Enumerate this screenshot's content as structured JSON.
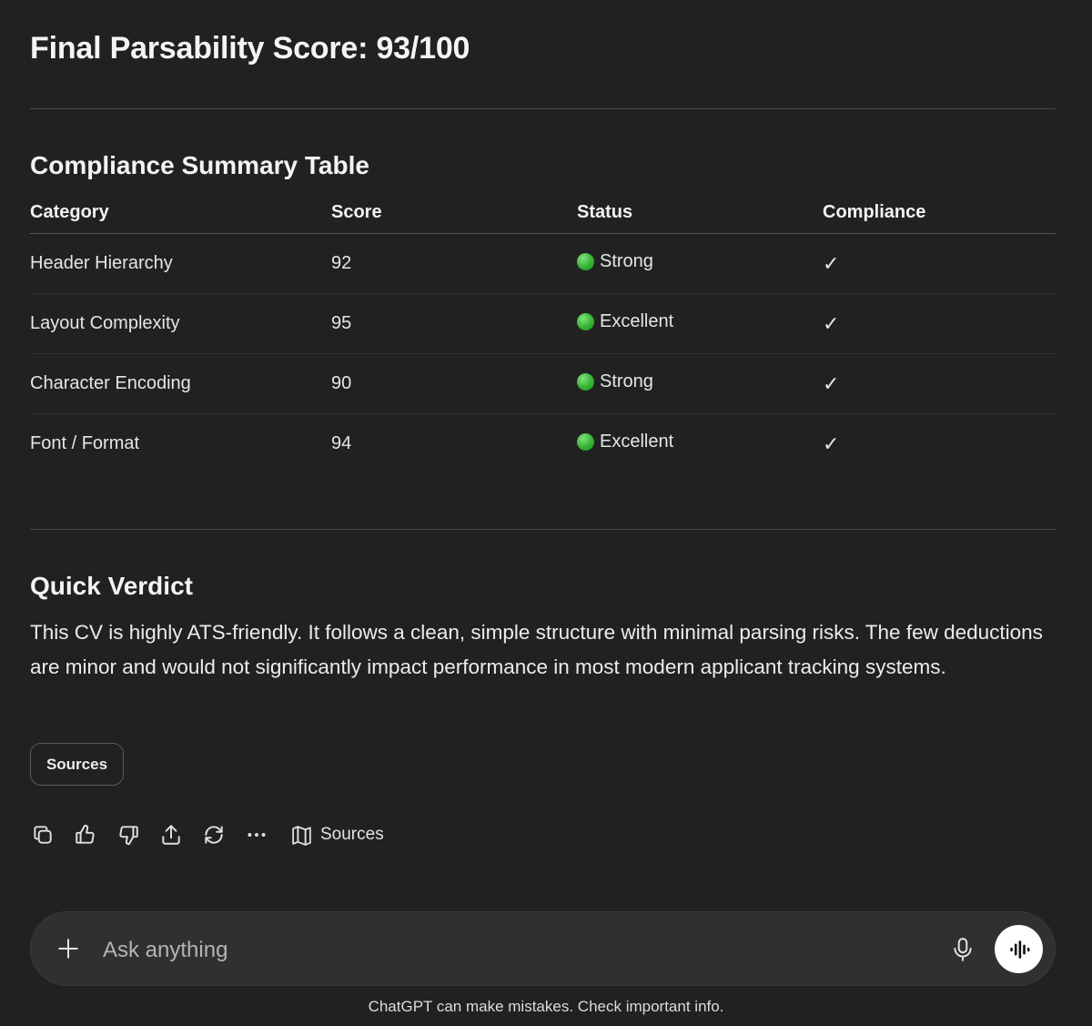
{
  "final_score": {
    "title": "Final Parsability Score: 93/100"
  },
  "compliance": {
    "heading": "Compliance Summary Table",
    "columns": [
      "Category",
      "Score",
      "Status",
      "Compliance"
    ],
    "rows": [
      {
        "category": "Header Hierarchy",
        "score": "92",
        "status": "Strong",
        "compliance": "✓"
      },
      {
        "category": "Layout Complexity",
        "score": "95",
        "status": "Excellent",
        "compliance": "✓"
      },
      {
        "category": "Character Encoding",
        "score": "90",
        "status": "Strong",
        "compliance": "✓"
      },
      {
        "category": "Font / Format",
        "score": "94",
        "status": "Excellent",
        "compliance": "✓"
      }
    ],
    "status_dot_color": "#34b233"
  },
  "verdict": {
    "heading": "Quick Verdict",
    "text": "This CV is highly ATS-friendly. It follows a clean, simple structure with minimal parsing risks. The few deductions are minor and would not significantly impact performance in most modern applicant tracking systems."
  },
  "sources_chip": {
    "label": "Sources"
  },
  "actions": {
    "icons": [
      "copy-icon",
      "thumbs-up-icon",
      "thumbs-down-icon",
      "share-icon",
      "regenerate-icon",
      "more-icon"
    ],
    "sources_label": "Sources"
  },
  "composer": {
    "placeholder": "Ask anything"
  },
  "footer": {
    "disclaimer": "ChatGPT can make mistakes. Check important info."
  }
}
